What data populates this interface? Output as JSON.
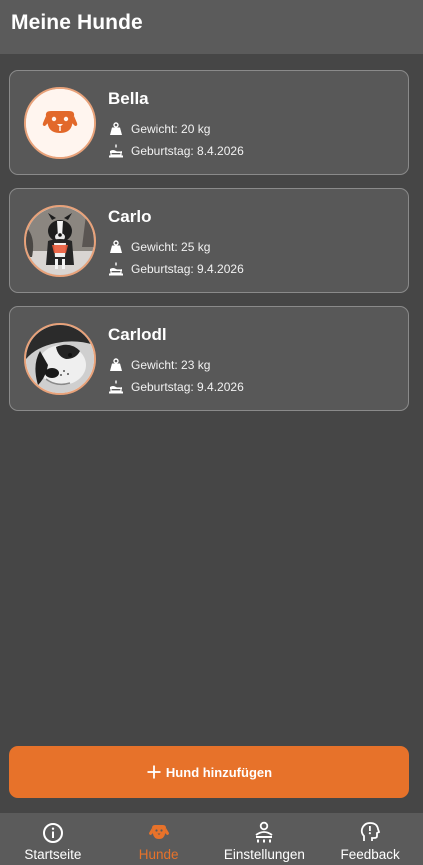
{
  "header": {
    "title": "Meine Hunde"
  },
  "dogs": [
    {
      "name": "Bella",
      "weight": "Gewicht: 20 kg",
      "birthday": "Geburtstag: 8.4.2026",
      "avatar": "dog-placeholder-icon"
    },
    {
      "name": "Carlo",
      "weight": "Gewicht: 25 kg",
      "birthday": "Geburtstag: 9.4.2026",
      "avatar": "dog-photo"
    },
    {
      "name": "Carlodl",
      "weight": "Gewicht: 23 kg",
      "birthday": "Geburtstag: 9.4.2026",
      "avatar": "dog-photo"
    }
  ],
  "actions": {
    "add_dog": "Hund hinzufügen"
  },
  "nav": {
    "items": [
      {
        "label": "Startseite",
        "icon": "info-circle-icon"
      },
      {
        "label": "Hunde",
        "icon": "dog-face-icon",
        "active": true
      },
      {
        "label": "Einstellungen",
        "icon": "person-settings-icon"
      },
      {
        "label": "Feedback",
        "icon": "feedback-head-icon"
      }
    ]
  },
  "colors": {
    "background": "#464646",
    "bar": "#5b5b5b",
    "card": "#585858",
    "accent": "#e7722a"
  }
}
